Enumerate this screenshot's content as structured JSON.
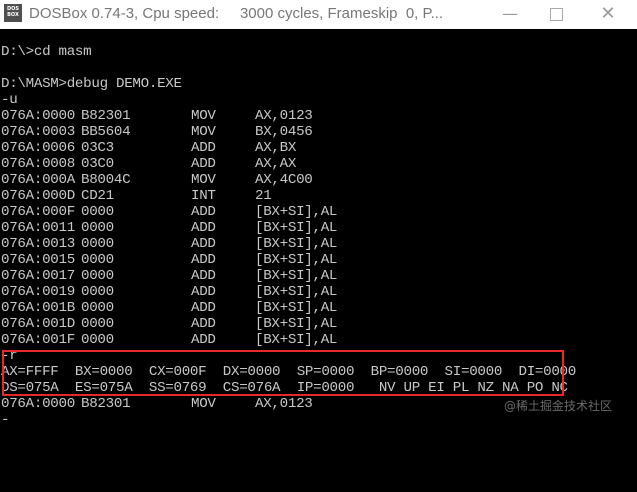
{
  "window": {
    "app_icon_line1": "DOS",
    "app_icon_line2": "BOX",
    "title": "DOSBox 0.74-3, Cpu speed:     3000 cycles, Frameskip  0, P...",
    "minimize_glyph": "—",
    "close_glyph": "✕"
  },
  "console": {
    "blank_lines_before": "",
    "cmd1": "D:\\>cd masm",
    "cmd2": "D:\\MASM>debug DEMO.EXE",
    "cmd3": "-u",
    "disasm": [
      {
        "addr": "076A:0000",
        "bytes": "B82301",
        "op": "MOV",
        "args": "AX,0123"
      },
      {
        "addr": "076A:0003",
        "bytes": "BB5604",
        "op": "MOV",
        "args": "BX,0456"
      },
      {
        "addr": "076A:0006",
        "bytes": "03C3",
        "op": "ADD",
        "args": "AX,BX"
      },
      {
        "addr": "076A:0008",
        "bytes": "03C0",
        "op": "ADD",
        "args": "AX,AX"
      },
      {
        "addr": "076A:000A",
        "bytes": "B8004C",
        "op": "MOV",
        "args": "AX,4C00"
      },
      {
        "addr": "076A:000D",
        "bytes": "CD21",
        "op": "INT",
        "args": "21"
      },
      {
        "addr": "076A:000F",
        "bytes": "0000",
        "op": "ADD",
        "args": "[BX+SI],AL"
      },
      {
        "addr": "076A:0011",
        "bytes": "0000",
        "op": "ADD",
        "args": "[BX+SI],AL"
      },
      {
        "addr": "076A:0013",
        "bytes": "0000",
        "op": "ADD",
        "args": "[BX+SI],AL"
      },
      {
        "addr": "076A:0015",
        "bytes": "0000",
        "op": "ADD",
        "args": "[BX+SI],AL"
      },
      {
        "addr": "076A:0017",
        "bytes": "0000",
        "op": "ADD",
        "args": "[BX+SI],AL"
      },
      {
        "addr": "076A:0019",
        "bytes": "0000",
        "op": "ADD",
        "args": "[BX+SI],AL"
      },
      {
        "addr": "076A:001B",
        "bytes": "0000",
        "op": "ADD",
        "args": "[BX+SI],AL"
      },
      {
        "addr": "076A:001D",
        "bytes": "0000",
        "op": "ADD",
        "args": "[BX+SI],AL"
      },
      {
        "addr": "076A:001F",
        "bytes": "0000",
        "op": "ADD",
        "args": "[BX+SI],AL"
      }
    ],
    "cmd4": "-r",
    "registers_line1": "AX=FFFF  BX=0000  CX=000F  DX=0000  SP=0000  BP=0000  SI=0000  DI=0000",
    "registers_line2": "DS=075A  ES=075A  SS=0769  CS=076A  IP=0000   NV UP EI PL NZ NA PO NC",
    "next_instr": {
      "addr": "076A:0000",
      "bytes": "B82301",
      "op": "MOV",
      "args": "AX,0123"
    },
    "prompt": "-"
  },
  "watermark": "@稀土掘金技术社区",
  "colors": {
    "console_bg": "#000000",
    "console_text": "#c8c8c8",
    "highlight_border": "#e8282a"
  }
}
